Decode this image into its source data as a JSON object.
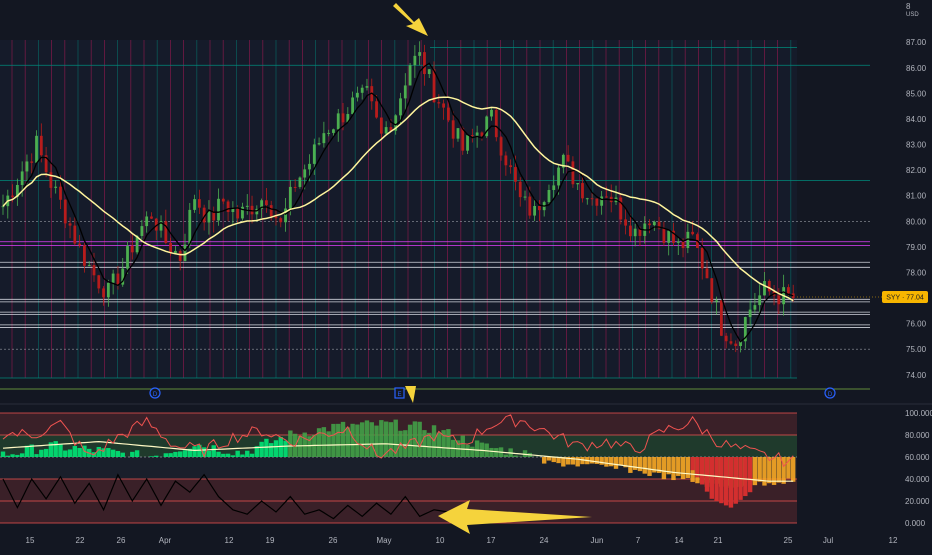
{
  "colors": {
    "background": "#131722",
    "bull": "#26a69a",
    "bear": "#ef5350",
    "candle_up": "#4caf50",
    "candle_down": "#b71c1c",
    "ma_fast": "#000000",
    "ma_slow": "#fff59d",
    "grid_red": "#c2185b",
    "grid_teal": "#00897b",
    "price_tag": "#f7b500",
    "arrow": "#f5d33c"
  },
  "price_axis": {
    "currency": "USD",
    "top_label": "8",
    "ticks": [
      "87.00",
      "86.00",
      "85.00",
      "84.00",
      "83.00",
      "82.00",
      "81.00",
      "80.00",
      "79.00",
      "78.00",
      "77.00",
      "76.00",
      "75.00",
      "74.00"
    ],
    "current_label": "SYY · 77.04"
  },
  "osc_axis": {
    "ticks": [
      "100.000",
      "80.000",
      "60.000",
      "40.000",
      "20.000",
      "0.000"
    ]
  },
  "time_axis": {
    "ticks": [
      "15",
      "22",
      "26",
      "Apr",
      "12",
      "19",
      "26",
      "May",
      "10",
      "17",
      "24",
      "Jun",
      "7",
      "14",
      "21",
      "25",
      "Jul",
      "12"
    ]
  },
  "markers": {
    "event_a": "D",
    "event_b": "E",
    "event_c": "D"
  },
  "chart_data": {
    "type": "candlestick",
    "symbol": "SYY",
    "last_price": 77.04,
    "ylim": [
      73.6,
      87.4
    ],
    "price_waypoints": [
      [
        0,
        80.6
      ],
      [
        4,
        82.0
      ],
      [
        7,
        83.0
      ],
      [
        10,
        81.5
      ],
      [
        13,
        80.3
      ],
      [
        16,
        78.9
      ],
      [
        19,
        77.9
      ],
      [
        22,
        77.2
      ],
      [
        25,
        78.2
      ],
      [
        28,
        79.5
      ],
      [
        31,
        80.3
      ],
      [
        34,
        79.2
      ],
      [
        37,
        78.6
      ],
      [
        40,
        81.0
      ],
      [
        43,
        80.0
      ],
      [
        46,
        80.8
      ],
      [
        49,
        80.2
      ],
      [
        52,
        80.6
      ],
      [
        55,
        81.0
      ],
      [
        58,
        79.8
      ],
      [
        61,
        81.5
      ],
      [
        64,
        82.3
      ],
      [
        67,
        83.5
      ],
      [
        70,
        84.0
      ],
      [
        73,
        84.6
      ],
      [
        76,
        84.9
      ],
      [
        79,
        83.3
      ],
      [
        82,
        84.3
      ],
      [
        85,
        86.2
      ],
      [
        87,
        86.4
      ],
      [
        90,
        85.1
      ],
      [
        93,
        84.0
      ],
      [
        96,
        82.8
      ],
      [
        99,
        83.5
      ],
      [
        102,
        84.0
      ],
      [
        105,
        82.5
      ],
      [
        108,
        80.8
      ],
      [
        111,
        80.3
      ],
      [
        114,
        81.6
      ],
      [
        117,
        82.3
      ],
      [
        120,
        81.5
      ],
      [
        123,
        80.9
      ],
      [
        126,
        81.2
      ],
      [
        129,
        80.4
      ],
      [
        132,
        79.6
      ],
      [
        135,
        80.2
      ],
      [
        138,
        79.6
      ],
      [
        141,
        79.0
      ],
      [
        144,
        79.3
      ],
      [
        147,
        77.9
      ],
      [
        150,
        75.9
      ],
      [
        153,
        75.3
      ],
      [
        156,
        76.6
      ],
      [
        159,
        77.3
      ],
      [
        162,
        77.1
      ],
      [
        165,
        77.0
      ]
    ],
    "levels_white": [
      78.4,
      78.2,
      76.95,
      76.85,
      76.45,
      76.35,
      75.95,
      75.85
    ],
    "levels_magenta": [
      79.2,
      79.05
    ],
    "level_teal": [
      86.1,
      81.6
    ],
    "level_dashed": [
      80.0,
      75.0
    ],
    "oscillator": {
      "ylim": [
        0,
        100
      ],
      "levels": [
        100,
        80,
        60,
        40,
        20,
        0
      ],
      "red_line": [
        [
          0,
          82
        ],
        [
          6,
          80
        ],
        [
          12,
          90
        ],
        [
          18,
          60
        ],
        [
          24,
          78
        ],
        [
          30,
          92
        ],
        [
          36,
          70
        ],
        [
          42,
          66
        ],
        [
          48,
          78
        ],
        [
          54,
          84
        ],
        [
          60,
          74
        ],
        [
          66,
          80
        ],
        [
          72,
          86
        ],
        [
          78,
          62
        ],
        [
          84,
          68
        ],
        [
          90,
          80
        ],
        [
          96,
          72
        ],
        [
          102,
          90
        ],
        [
          108,
          94
        ],
        [
          114,
          82
        ],
        [
          120,
          70
        ],
        [
          126,
          74
        ],
        [
          132,
          66
        ],
        [
          138,
          84
        ],
        [
          144,
          92
        ],
        [
          150,
          72
        ],
        [
          156,
          64
        ],
        [
          162,
          58
        ],
        [
          165,
          56
        ]
      ],
      "black_line": [
        [
          0,
          40
        ],
        [
          3,
          14
        ],
        [
          6,
          40
        ],
        [
          9,
          22
        ],
        [
          12,
          42
        ],
        [
          15,
          18
        ],
        [
          18,
          36
        ],
        [
          21,
          12
        ],
        [
          24,
          44
        ],
        [
          27,
          20
        ],
        [
          30,
          40
        ],
        [
          33,
          16
        ],
        [
          36,
          38
        ],
        [
          39,
          28
        ],
        [
          42,
          44
        ],
        [
          45,
          24
        ],
        [
          48,
          12
        ],
        [
          51,
          8
        ],
        [
          54,
          20
        ],
        [
          57,
          10
        ],
        [
          60,
          24
        ],
        [
          63,
          8
        ],
        [
          66,
          12
        ],
        [
          69,
          4
        ],
        [
          72,
          16
        ],
        [
          75,
          6
        ],
        [
          78,
          18
        ],
        [
          81,
          8
        ],
        [
          84,
          24
        ],
        [
          87,
          6
        ],
        [
          90,
          12
        ],
        [
          93,
          10
        ],
        [
          96,
          14
        ]
      ],
      "yellow_line": [
        [
          0,
          68
        ],
        [
          20,
          74
        ],
        [
          40,
          66
        ],
        [
          60,
          70
        ],
        [
          80,
          72
        ],
        [
          100,
          66
        ],
        [
          120,
          58
        ],
        [
          140,
          46
        ],
        [
          160,
          38
        ],
        [
          165,
          38
        ]
      ],
      "histogram_green": [
        [
          0,
          62
        ],
        [
          10,
          70
        ],
        [
          20,
          66
        ],
        [
          30,
          60
        ],
        [
          40,
          72
        ],
        [
          50,
          64
        ],
        [
          60,
          80
        ],
        [
          70,
          88
        ],
        [
          80,
          90
        ],
        [
          90,
          86
        ],
        [
          100,
          70
        ],
        [
          108,
          64
        ],
        [
          112,
          60
        ]
      ],
      "histogram_orange": [
        [
          112,
          58
        ],
        [
          120,
          56
        ],
        [
          130,
          52
        ],
        [
          140,
          44
        ],
        [
          150,
          36
        ],
        [
          160,
          40
        ],
        [
          165,
          42
        ]
      ],
      "histogram_red": [
        [
          144,
          48
        ],
        [
          148,
          22
        ],
        [
          152,
          14
        ],
        [
          156,
          28
        ]
      ]
    }
  }
}
